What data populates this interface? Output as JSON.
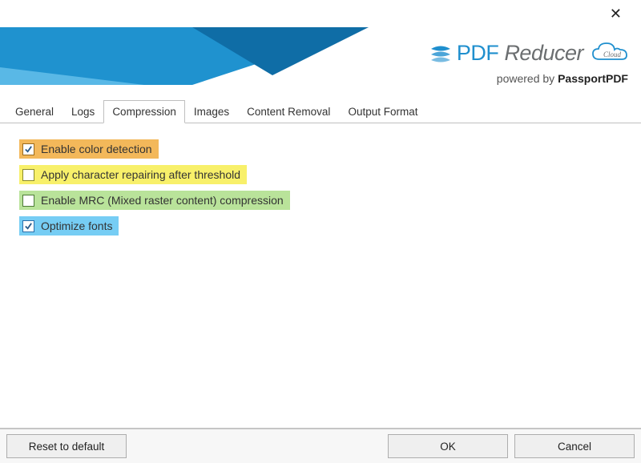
{
  "titlebar": {
    "close": "✕"
  },
  "header": {
    "brand_pdf": "PDF",
    "brand_reducer": "Reducer",
    "powered_prefix": "powered by ",
    "powered_name": "PassportPDF"
  },
  "tabs": [
    {
      "label": "General",
      "active": false
    },
    {
      "label": "Logs",
      "active": false
    },
    {
      "label": "Compression",
      "active": true
    },
    {
      "label": "Images",
      "active": false
    },
    {
      "label": "Content Removal",
      "active": false
    },
    {
      "label": "Output Format",
      "active": false
    }
  ],
  "options": {
    "color_detection": {
      "label": "Enable color detection",
      "checked": true,
      "highlight": "orange"
    },
    "char_repair": {
      "label": "Apply character repairing after threshold",
      "checked": false,
      "highlight": "yellow"
    },
    "mrc": {
      "label": "Enable MRC (Mixed raster content) compression",
      "checked": false,
      "highlight": "green"
    },
    "optimize_fonts": {
      "label": "Optimize fonts",
      "checked": true,
      "highlight": "blue"
    }
  },
  "footer": {
    "reset": "Reset to default",
    "ok": "OK",
    "cancel": "Cancel"
  },
  "colors": {
    "brand_blue": "#1f8fce",
    "brand_gray": "#6b6e70",
    "highlight_orange": "#f3b85a",
    "highlight_yellow": "#f8f06a",
    "highlight_green": "#b9e39a",
    "highlight_blue": "#76cdf4"
  }
}
